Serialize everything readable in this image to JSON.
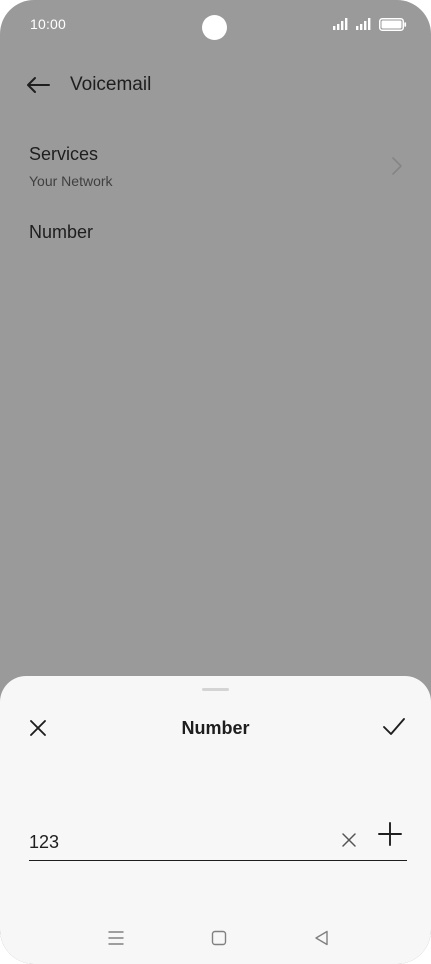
{
  "status_bar": {
    "time": "10:00",
    "icons": [
      "signal-icon",
      "signal-icon",
      "battery-icon"
    ]
  },
  "app_bar": {
    "back_icon": "arrow-left-icon",
    "title": "Voicemail"
  },
  "settings": {
    "items": [
      {
        "title": "Services",
        "subtitle": "Your Network",
        "icon": "chevron-right-icon"
      },
      {
        "title": "Number"
      }
    ]
  },
  "dialog": {
    "title": "Number",
    "close_icon": "close-icon",
    "confirm_icon": "checkmark-icon",
    "input": {
      "value": "123",
      "placeholder": "",
      "clear_icon": "clear-icon",
      "add_icon": "plus-icon"
    }
  },
  "nav_bar": {
    "icons": [
      "menu-icon",
      "home-icon",
      "back-triangle-icon"
    ]
  },
  "colors": {
    "scrim": "#9a9a9a",
    "sheet_background": "#f7f7f7",
    "text_primary": "#1e1e1e",
    "status_bar_text": "#ffffff"
  }
}
